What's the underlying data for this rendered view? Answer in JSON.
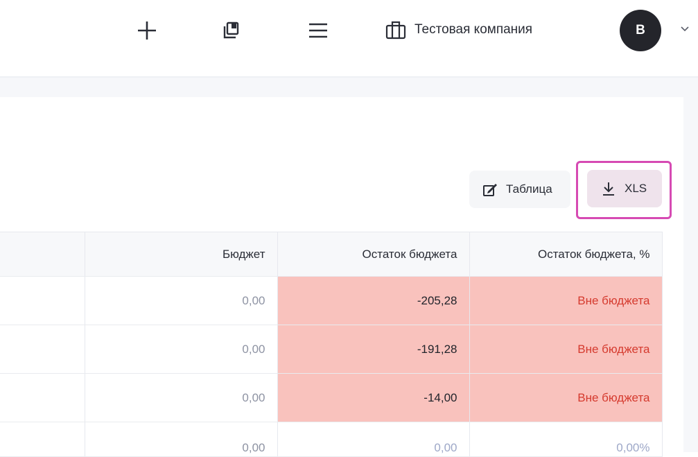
{
  "header": {
    "company_name": "Тестовая компания",
    "avatar_initial": "В",
    "icons": [
      "plus-icon",
      "copy-icon",
      "menu-icon",
      "briefcase-icon",
      "chevron-down-icon"
    ]
  },
  "toolbar": {
    "table_label": "Таблица",
    "xls_label": "XLS",
    "highlight_color": "#d64ab3"
  },
  "table": {
    "columns": [
      "",
      "Бюджет",
      "Остаток бюджета",
      "Остаток бюджета, %"
    ],
    "rows": [
      {
        "budget": "0,00",
        "remaining": "-205,28",
        "remaining_pct": "Вне бюджета"
      },
      {
        "budget": "0,00",
        "remaining": "-191,28",
        "remaining_pct": "Вне бюджета"
      },
      {
        "budget": "0,00",
        "remaining": "-14,00",
        "remaining_pct": "Вне бюджета"
      },
      {
        "budget": "0,00",
        "remaining": "0,00",
        "remaining_pct": "0,00%"
      }
    ]
  },
  "colors": {
    "over_budget_bg": "#f9c2bd",
    "over_budget_text": "#d53a2e",
    "avatar_bg": "#24252b"
  }
}
